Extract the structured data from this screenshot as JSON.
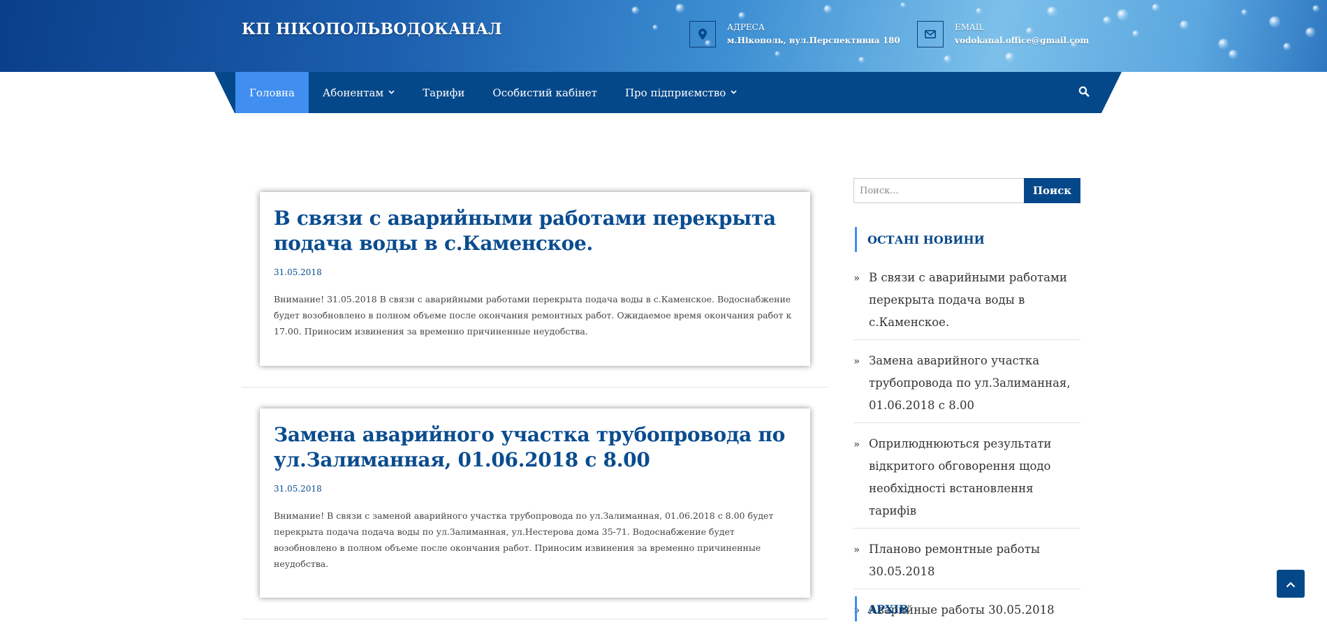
{
  "header": {
    "site_title": "КП НІКОПОЛЬВОДОКАНАЛ",
    "address": {
      "label": "АДРЕСА",
      "value": "м.Нікополь, вул.Перспективна 180",
      "icon": "map-marker-icon"
    },
    "email": {
      "label": "EMAIL",
      "value": "vodokanal.office@gmail.com",
      "icon": "envelope-icon"
    }
  },
  "nav": {
    "items": [
      {
        "label": "Головна",
        "active": true
      },
      {
        "label": "Абонентам",
        "dropdown": true
      },
      {
        "label": "Тарифи"
      },
      {
        "label": "Особистий кабінет"
      },
      {
        "label": "Про підприємство",
        "dropdown": true
      }
    ],
    "search_icon": "search-icon"
  },
  "posts": [
    {
      "title": "В связи с аварийными работами перекрыта подача воды в с.Каменское.",
      "date": "31.05.2018",
      "excerpt": "Внимание! 31.05.2018 В связи с аварийными работами перекрыта подача воды в с.Каменское. Водоснабжение будет возобновлено в полном объеме после окончания ремонтных работ. Ожидаемое время окончания работ к 17.00. Приносим извинения за временно причиненные неудобства."
    },
    {
      "title": "Замена аварийного участка трубопровода по ул.Залиманная, 01.06.2018 с 8.00",
      "date": "31.05.2018",
      "excerpt": "Внимание!   В связи с заменой аварийного участка трубопровода по ул.Залиманная, 01.06.2018 с 8.00 будет перекрыта подача подача воды по ул.Залиманная, ул.Нестерова дома 35-71.   Водоснабжение будет возобновлено в полном объеме после окончания работ. Приносим извинения за временно причиненные неудобства."
    }
  ],
  "sidebar": {
    "search": {
      "placeholder": "Поиск...",
      "button": "Поиск"
    },
    "recent_title": "ОСТАНІ НОВИНИ",
    "recent": [
      "В связи с аварийными работами перекрыта подача воды в с.Каменское.",
      "Замена аварийного участка трубопровода по ул.Залиманная, 01.06.2018 с 8.00",
      "Оприлюднюються результати відкритого обговорення щодо необхідності встановлення тарифів",
      "Планово ремонтные работы 30.05.2018",
      "Аварийные работы 30.05.2018"
    ],
    "archive_title": "АРХІВ"
  },
  "colors": {
    "primary": "#05488a",
    "accent": "#3f8ef0",
    "title": "#0a4c8f"
  },
  "back_to_top_icon": "chevron-up-icon"
}
